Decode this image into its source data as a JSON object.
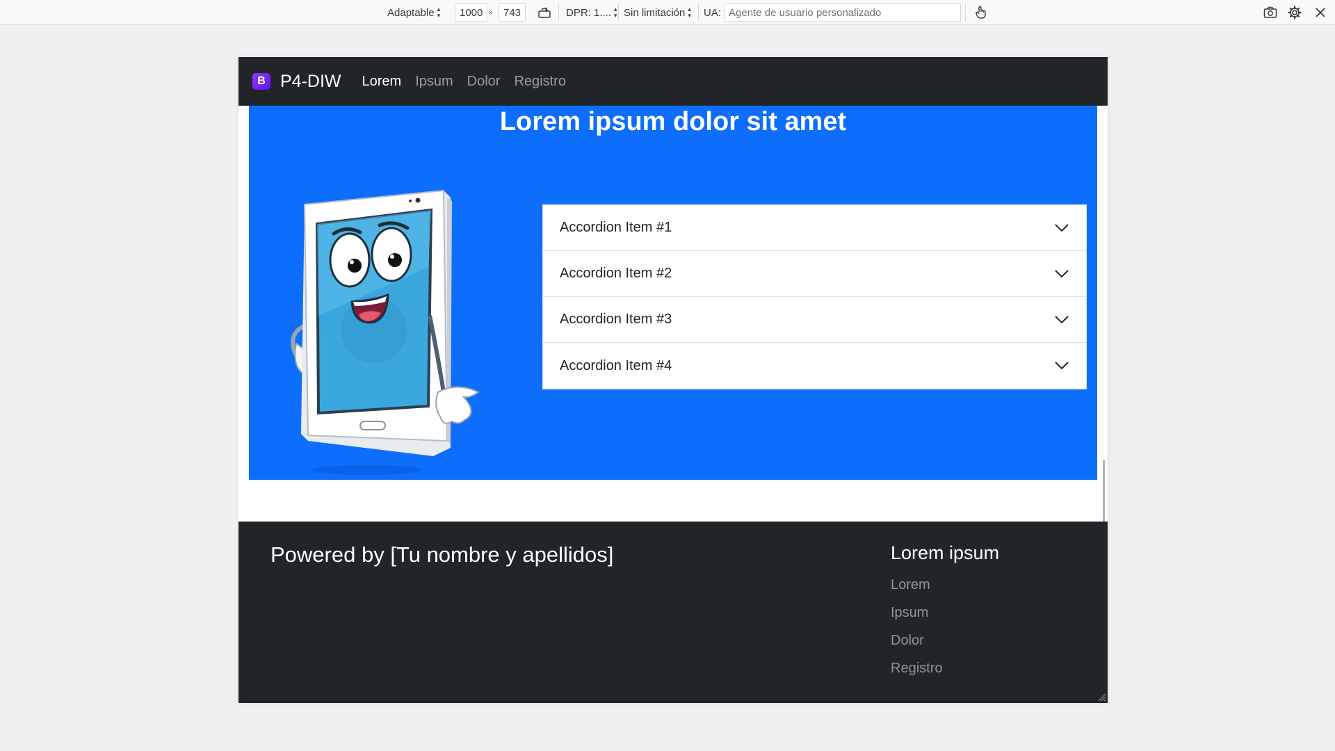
{
  "rdm": {
    "device": "Adaptable",
    "width": "1000",
    "height": "743",
    "times": "×",
    "dpr": "DPR: 1....",
    "throttle": "Sin limitación",
    "ua_label": "UA:",
    "ua_placeholder": "Agente de usuario personalizado"
  },
  "navbar": {
    "logo_letter": "B",
    "brand": "P4-DIW",
    "links": [
      {
        "label": "Lorem",
        "active": true
      },
      {
        "label": "Ipsum",
        "active": false
      },
      {
        "label": "Dolor",
        "active": false
      },
      {
        "label": "Registro",
        "active": false
      }
    ]
  },
  "hero": {
    "title": "Lorem ipsum dolor sit amet",
    "accordion": [
      {
        "label": "Accordion Item #1"
      },
      {
        "label": "Accordion Item #2"
      },
      {
        "label": "Accordion Item #3"
      },
      {
        "label": "Accordion Item #4"
      }
    ]
  },
  "footer": {
    "powered": "Powered by [Tu nombre y apellidos]",
    "heading": "Lorem ipsum",
    "links": [
      "Lorem",
      "Ipsum",
      "Dolor",
      "Registro"
    ]
  },
  "colors": {
    "navbar_bg": "#212529",
    "hero_bg": "#0d6efd",
    "brand_purple": "#6610f2"
  },
  "icons": {
    "rotate": "rotate-icon",
    "touch": "touch-icon",
    "screenshot": "camera-icon",
    "settings": "gear-icon",
    "close": "close-icon",
    "accordion": "chevron-down-icon"
  }
}
